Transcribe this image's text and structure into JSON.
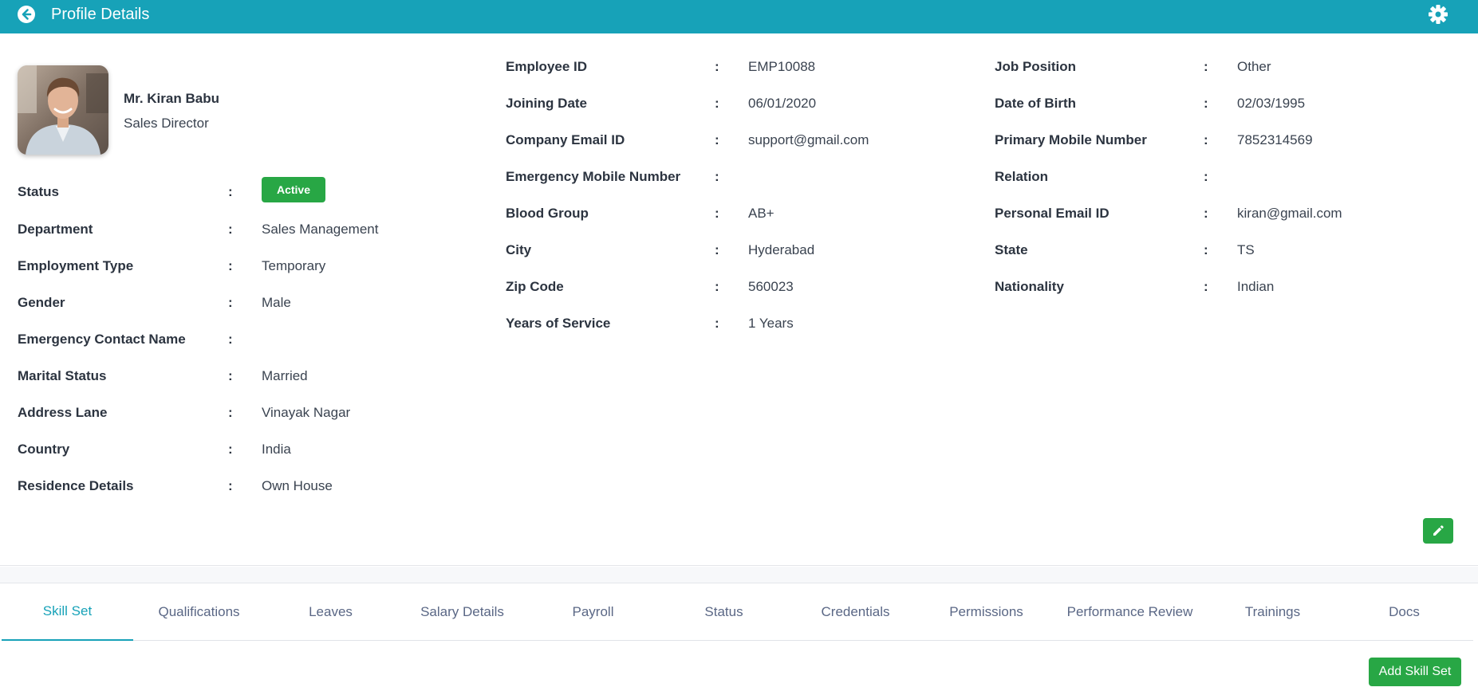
{
  "header": {
    "title": "Profile Details",
    "back_icon": "arrow-left-circle-icon",
    "settings_icon": "gear-icon",
    "color": "#17a2b8"
  },
  "employee": {
    "name": "Mr. Kiran Babu",
    "role": "Sales Director"
  },
  "column1": [
    {
      "label": "Status",
      "value": "Active"
    },
    {
      "label": "Department",
      "value": "Sales Management"
    },
    {
      "label": "Employment Type",
      "value": "Temporary"
    },
    {
      "label": "Gender",
      "value": "Male"
    },
    {
      "label": "Emergency Contact Name",
      "value": ""
    },
    {
      "label": "Marital Status",
      "value": "Married"
    },
    {
      "label": "Address Lane",
      "value": "Vinayak Nagar"
    },
    {
      "label": "Country",
      "value": "India"
    },
    {
      "label": "Residence Details",
      "value": "Own House"
    }
  ],
  "column2": [
    {
      "label": "Employee ID",
      "value": "EMP10088"
    },
    {
      "label": "Joining Date",
      "value": "06/01/2020"
    },
    {
      "label": "Company Email ID",
      "value": "support@gmail.com"
    },
    {
      "label": "Emergency Mobile Number",
      "value": ""
    },
    {
      "label": "Blood Group",
      "value": "AB+"
    },
    {
      "label": "City",
      "value": "Hyderabad"
    },
    {
      "label": "Zip Code",
      "value": "560023"
    },
    {
      "label": "Years of Service",
      "value": "1 Years"
    }
  ],
  "column3": [
    {
      "label": "Job Position",
      "value": "Other"
    },
    {
      "label": "Date of Birth",
      "value": "02/03/1995"
    },
    {
      "label": "Primary Mobile Number",
      "value": "7852314569"
    },
    {
      "label": "Relation",
      "value": ""
    },
    {
      "label": "Personal Email ID",
      "value": "kiran@gmail.com"
    },
    {
      "label": "State",
      "value": "TS"
    },
    {
      "label": "Nationality",
      "value": "Indian"
    }
  ],
  "separator": ":",
  "status_color": "#28a745",
  "edit_icon": "pencil-icon",
  "tabs": [
    {
      "label": "Skill Set"
    },
    {
      "label": "Qualifications"
    },
    {
      "label": "Leaves"
    },
    {
      "label": "Salary Details"
    },
    {
      "label": "Payroll"
    },
    {
      "label": "Status"
    },
    {
      "label": "Credentials"
    },
    {
      "label": "Permissions"
    },
    {
      "label": "Performance Review"
    },
    {
      "label": "Trainings"
    },
    {
      "label": "Docs"
    }
  ],
  "active_tab": "Skill Set",
  "add_button_label": "Add Skill Set"
}
